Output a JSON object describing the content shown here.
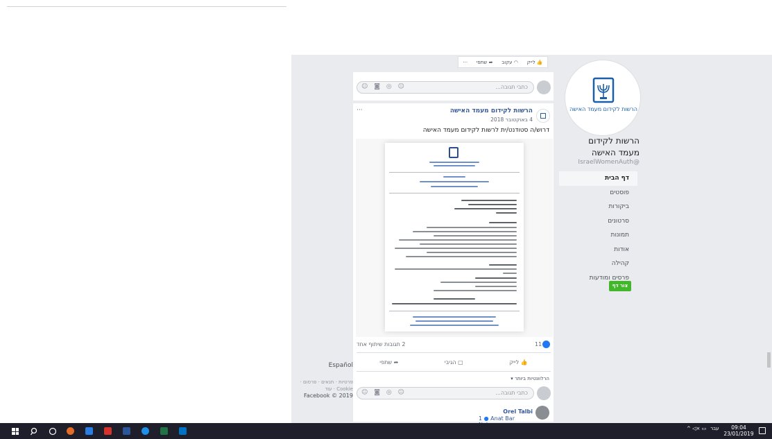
{
  "colors": {
    "fb_background": "#e9ebee",
    "link_blue": "#365899",
    "create_page_green": "#42b72a",
    "like_blue": "#2078f4",
    "taskbar": "#1f1f2b"
  },
  "sidebar": {
    "profile_org_text": "הרשות לקידום מעמד האישה",
    "page_name": "הרשות לקידום מעמד האישה",
    "page_handle": "IsraelWomenAuth@",
    "nav_items": [
      {
        "label": "דף הבית",
        "active": true
      },
      {
        "label": "פוסטים",
        "active": false
      },
      {
        "label": "ביקורות",
        "active": false
      },
      {
        "label": "סרטונים",
        "active": false
      },
      {
        "label": "תמונות",
        "active": false
      },
      {
        "label": "אודות",
        "active": false
      },
      {
        "label": "קהילה",
        "active": false
      },
      {
        "label": "פרסים ומודעות",
        "active": false
      }
    ],
    "create_page_button": "צור דף"
  },
  "footer": {
    "language": "Español",
    "links": "פרטיות · תנאים · פרסום · Cookie · עוד",
    "copyright": "Facebook © 2019"
  },
  "top_actions": {
    "like": "לייק",
    "follow": "עקוב",
    "share": "שתפי",
    "more": "···"
  },
  "comment_placeholder": "כתבי תגובה...",
  "comment_icons": "☺ ◙ ◎ ☺",
  "post": {
    "author": "הרשות לקידום מעמד האישה",
    "date": "4 באוקטובר 2018",
    "text": "דרוש/ה סטודנט/ית לרשות לקידום מעמד האישה",
    "more": "···",
    "likes_count": "11",
    "comments_shares": "2 תגובות  שיתוף אחד",
    "actions": {
      "like": "לייק",
      "comment": "הגיבי",
      "share": "שתפי"
    },
    "sort_label": "הרלוונטיות ביותר ▾"
  },
  "comments": [
    {
      "name": "Orel Talbi",
      "reply_preview": "Anat Bar Nahum"
    }
  ],
  "comment_reply_count": "1",
  "taskbar": {
    "time": "09:04",
    "date": "23/01/2019",
    "lang": "עבר",
    "tray_icons": "^  ◁×  ▭"
  }
}
